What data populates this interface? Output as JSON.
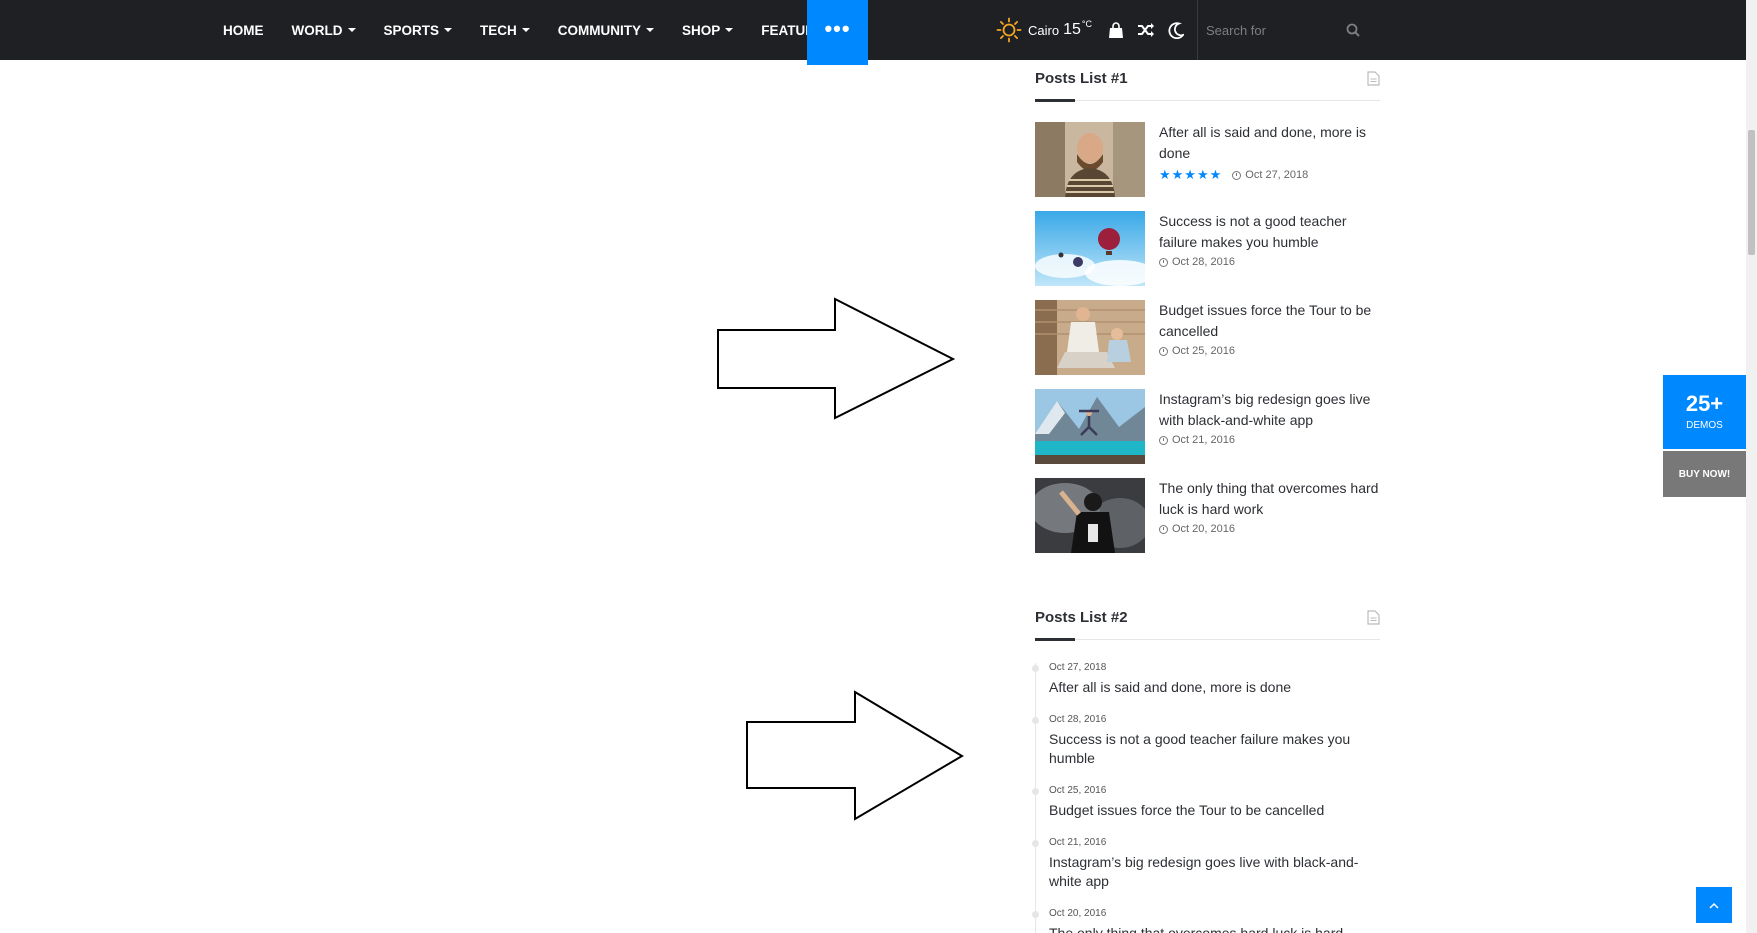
{
  "nav": {
    "items": [
      {
        "label": "HOME",
        "dropdown": false
      },
      {
        "label": "WORLD",
        "dropdown": true
      },
      {
        "label": "SPORTS",
        "dropdown": true
      },
      {
        "label": "TECH",
        "dropdown": true
      },
      {
        "label": "COMMUNITY",
        "dropdown": true
      },
      {
        "label": "SHOP",
        "dropdown": true
      },
      {
        "label": "FEATURES",
        "dropdown": true
      }
    ],
    "more_label": "•••",
    "accent": "#0088ff",
    "background": "#1f2024"
  },
  "weather": {
    "city": "Cairo",
    "temp": "15",
    "unit": "°C",
    "icon": "sun-icon"
  },
  "nav_icons": [
    "shopping-bag-icon",
    "random-shuffle-icon",
    "dark-mode-moon-icon"
  ],
  "search": {
    "placeholder": "Search for",
    "icon": "search-icon"
  },
  "posts_list_1": {
    "title": "Posts List #1",
    "icon": "document-icon",
    "items": [
      {
        "title": "After all is said and done, more is done",
        "date": "Oct 27, 2018",
        "rating": "★★★★★",
        "thumb": "bearded-man-headphones"
      },
      {
        "title": "Success is not a good teacher failure makes you humble",
        "date": "Oct 28, 2016",
        "thumb": "hot-air-balloons"
      },
      {
        "title": "Budget issues force the Tour to be cancelled",
        "date": "Oct 25, 2016",
        "thumb": "man-and-child-on-deck"
      },
      {
        "title": "Instagram’s big redesign goes live with black-and-white app",
        "date": "Oct 21, 2016",
        "thumb": "man-jumping-mountain-lake"
      },
      {
        "title": "The only thing that overcomes hard luck is hard work",
        "date": "Oct 20, 2016",
        "thumb": "football-player-smoke"
      }
    ]
  },
  "posts_list_2": {
    "title": "Posts List #2",
    "icon": "document-icon",
    "items": [
      {
        "date": "Oct 27, 2018",
        "title": "After all is said and done, more is done"
      },
      {
        "date": "Oct 28, 2016",
        "title": "Success is not a good teacher failure makes you humble"
      },
      {
        "date": "Oct 25, 2016",
        "title": "Budget issues force the Tour to be cancelled"
      },
      {
        "date": "Oct 21, 2016",
        "title": "Instagram’s big redesign goes live with black-and-white app"
      },
      {
        "date": "Oct 20, 2016",
        "title": "The only thing that overcomes hard luck is hard work"
      }
    ]
  },
  "demos": {
    "count": "25+",
    "label": "DEMOS"
  },
  "buy": {
    "label": "BUY NOW!"
  },
  "back_to_top": {
    "icon": "chevron-up-icon"
  }
}
